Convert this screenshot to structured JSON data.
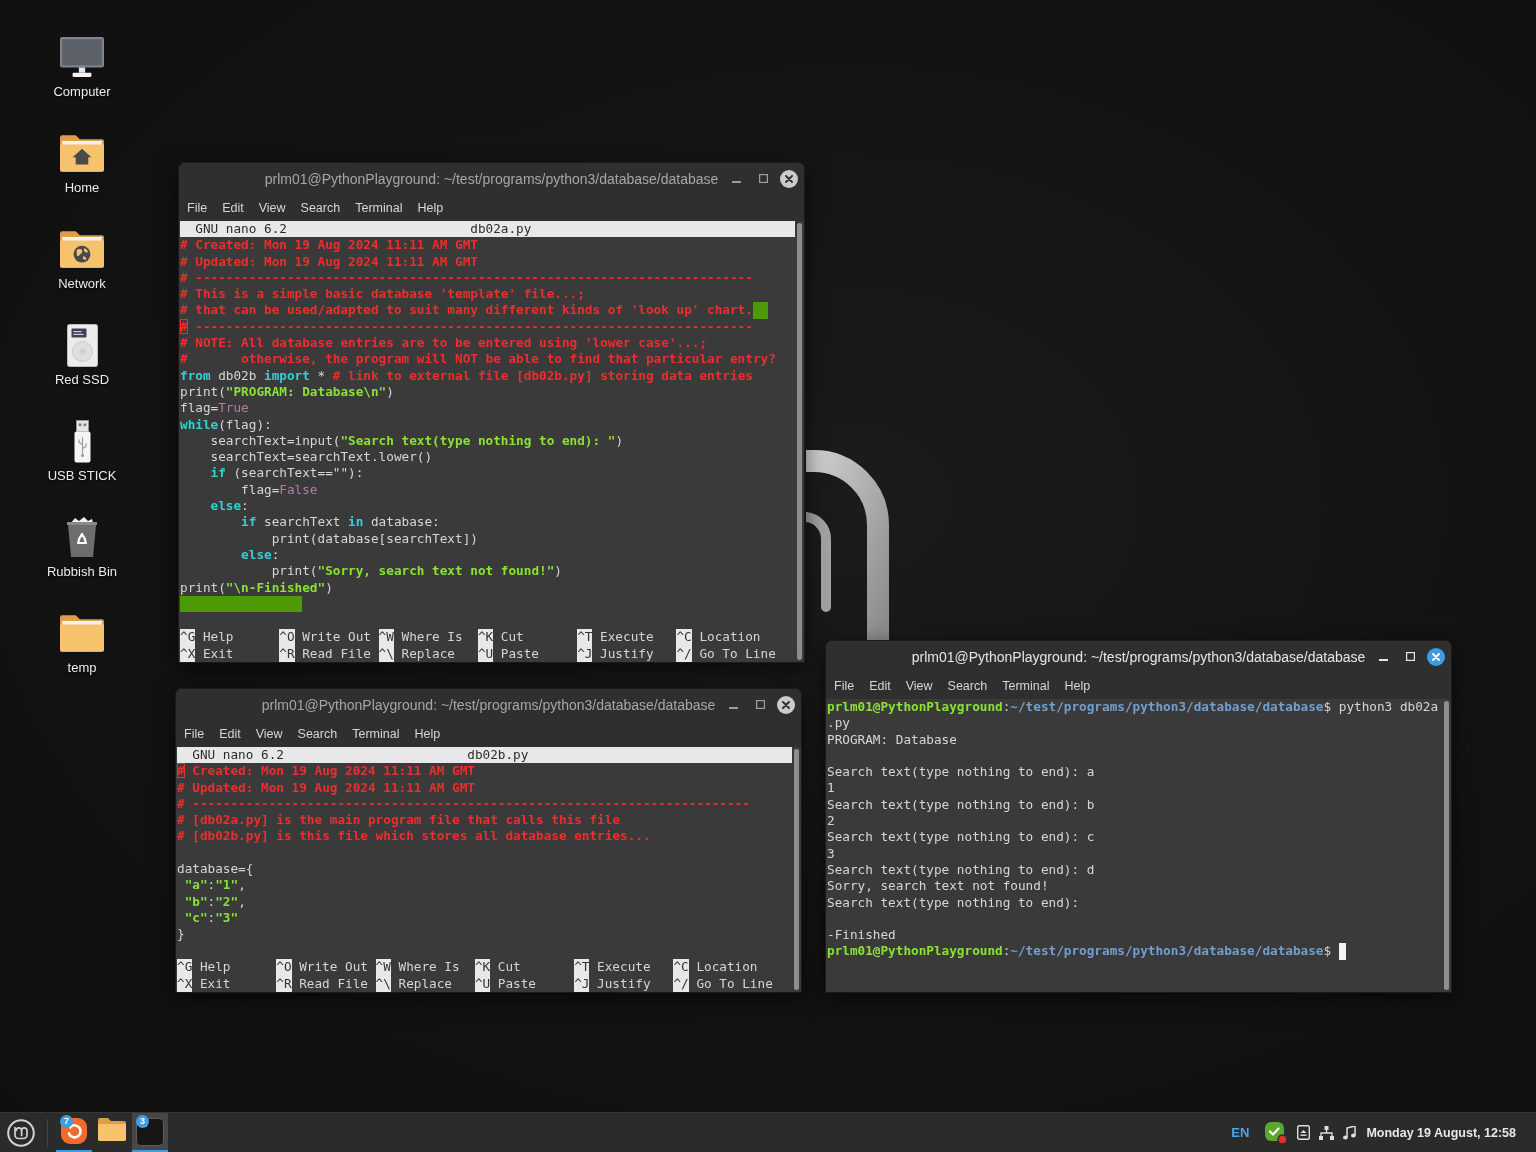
{
  "desktop_icons": [
    {
      "kind": "computer",
      "label": "Computer"
    },
    {
      "kind": "home",
      "label": "Home"
    },
    {
      "kind": "network",
      "label": "Network"
    },
    {
      "kind": "drive",
      "label": "Red SSD"
    },
    {
      "kind": "usb",
      "label": "USB STICK"
    },
    {
      "kind": "trash",
      "label": "Rubbish Bin"
    },
    {
      "kind": "folder",
      "label": "temp"
    }
  ],
  "windows": [
    {
      "kind": "nano",
      "active": false,
      "title": "prlm01@PythonPlayground: ~/test/programs/python3/database/database",
      "menu": [
        "File",
        "Edit",
        "View",
        "Search",
        "Terminal",
        "Help"
      ],
      "editor": {
        "version": "GNU nano 6.2",
        "filename": "db02a.py"
      },
      "lines": [
        {
          "kind": "code",
          "spans": [
            {
              "kind": "comment",
              "t": "# Created: Mon 19 Aug 2024 11:11 AM GMT"
            }
          ]
        },
        {
          "kind": "code",
          "spans": [
            {
              "kind": "comment",
              "t": "# Updated: Mon 19 Aug 2024 11:11 AM GMT"
            }
          ]
        },
        {
          "kind": "code",
          "spans": [
            {
              "kind": "comment",
              "t": "# -------------------------------------------------------------------------"
            }
          ]
        },
        {
          "kind": "code",
          "spans": [
            {
              "kind": "comment",
              "t": "# This is a simple basic database 'template' file...;"
            }
          ]
        },
        {
          "kind": "code",
          "spans": [
            {
              "kind": "comment",
              "t": "# that can be used/adapted to suit many different kinds of 'look up' chart."
            },
            {
              "kind": "space"
            },
            {
              "kind": "space"
            }
          ]
        },
        {
          "kind": "code",
          "spans": [
            {
              "kind": "comment",
              "t": "#",
              "cursor": true
            },
            {
              "kind": "comment",
              "t": " -------------------------------------------------------------------------"
            }
          ]
        },
        {
          "kind": "code",
          "spans": [
            {
              "kind": "comment",
              "t": "# NOTE: All database entries are to be entered using 'lower case'...;"
            }
          ]
        },
        {
          "kind": "code",
          "spans": [
            {
              "kind": "comment",
              "t": "#       otherwise, the program will NOT be able to find that particular entry?"
            }
          ]
        },
        {
          "kind": "code",
          "spans": [
            {
              "kind": "keyword",
              "t": "from"
            },
            {
              "kind": "plain",
              "t": " db02b "
            },
            {
              "kind": "keyword",
              "t": "import"
            },
            {
              "kind": "plain",
              "t": " * "
            },
            {
              "kind": "comment",
              "t": "# link to external file [db02b.py] storing data entries"
            }
          ]
        },
        {
          "kind": "code",
          "spans": [
            {
              "kind": "plain",
              "t": "print("
            },
            {
              "kind": "string",
              "t": "\"PROGRAM: Database\\n\""
            },
            {
              "kind": "plain",
              "t": ")"
            }
          ]
        },
        {
          "kind": "code",
          "spans": [
            {
              "kind": "plain",
              "t": "flag="
            },
            {
              "kind": "constant",
              "t": "True"
            }
          ]
        },
        {
          "kind": "code",
          "spans": [
            {
              "kind": "keyword",
              "t": "while"
            },
            {
              "kind": "plain",
              "t": "(flag):"
            }
          ]
        },
        {
          "kind": "code",
          "spans": [
            {
              "kind": "plain",
              "t": "    searchText=input("
            },
            {
              "kind": "string",
              "t": "\"Search text(type nothing to end): \""
            },
            {
              "kind": "plain",
              "t": ")"
            }
          ]
        },
        {
          "kind": "code",
          "spans": [
            {
              "kind": "plain",
              "t": "    searchText=searchText.lower()"
            }
          ]
        },
        {
          "kind": "code",
          "spans": [
            {
              "kind": "keyword",
              "t": "    if"
            },
            {
              "kind": "plain",
              "t": " (searchText==\"\"):"
            }
          ]
        },
        {
          "kind": "code",
          "spans": [
            {
              "kind": "plain",
              "t": "        flag="
            },
            {
              "kind": "constant",
              "t": "False"
            }
          ]
        },
        {
          "kind": "code",
          "spans": [
            {
              "kind": "keyword",
              "t": "    else"
            },
            {
              "kind": "plain",
              "t": ":"
            }
          ]
        },
        {
          "kind": "code",
          "spans": [
            {
              "kind": "keyword",
              "t": "        if"
            },
            {
              "kind": "plain",
              "t": " searchText "
            },
            {
              "kind": "keyword",
              "t": "in"
            },
            {
              "kind": "plain",
              "t": " database:"
            }
          ]
        },
        {
          "kind": "code",
          "spans": [
            {
              "kind": "plain",
              "t": "            print(database[searchText])"
            }
          ]
        },
        {
          "kind": "code",
          "spans": [
            {
              "kind": "keyword",
              "t": "        else"
            },
            {
              "kind": "plain",
              "t": ":"
            }
          ]
        },
        {
          "kind": "code",
          "spans": [
            {
              "kind": "plain",
              "t": "            print("
            },
            {
              "kind": "string",
              "t": "\"Sorry, search text not found!\""
            },
            {
              "kind": "plain",
              "t": ")"
            }
          ]
        },
        {
          "kind": "code",
          "spans": [
            {
              "kind": "plain",
              "t": "print("
            },
            {
              "kind": "string",
              "t": "\"\\n-Finished\""
            },
            {
              "kind": "plain",
              "t": ")"
            }
          ]
        },
        {
          "kind": "code",
          "spans": [
            {
              "kind": "space"
            },
            {
              "kind": "space"
            },
            {
              "kind": "space"
            },
            {
              "kind": "space"
            },
            {
              "kind": "space"
            },
            {
              "kind": "space"
            },
            {
              "kind": "space"
            },
            {
              "kind": "space"
            },
            {
              "kind": "space"
            },
            {
              "kind": "space"
            },
            {
              "kind": "space"
            },
            {
              "kind": "space"
            },
            {
              "kind": "space"
            },
            {
              "kind": "space"
            },
            {
              "kind": "space"
            },
            {
              "kind": "space"
            }
          ]
        }
      ],
      "shortcut_rows": [
        [
          {
            "key": "^G",
            "label": "Help"
          },
          {
            "key": "^O",
            "label": "Write Out"
          },
          {
            "key": "^W",
            "label": "Where Is"
          },
          {
            "key": "^K",
            "label": "Cut"
          },
          {
            "key": "^T",
            "label": "Execute"
          },
          {
            "key": "^C",
            "label": "Location"
          }
        ],
        [
          {
            "key": "^X",
            "label": "Exit"
          },
          {
            "key": "^R",
            "label": "Read File"
          },
          {
            "key": "^\\",
            "label": "Replace"
          },
          {
            "key": "^U",
            "label": "Paste"
          },
          {
            "key": "^J",
            "label": "Justify"
          },
          {
            "key": "^/",
            "label": "Go To Line"
          }
        ]
      ]
    },
    {
      "kind": "nano",
      "active": false,
      "title": "prlm01@PythonPlayground: ~/test/programs/python3/database/database",
      "menu": [
        "File",
        "Edit",
        "View",
        "Search",
        "Terminal",
        "Help"
      ],
      "editor": {
        "version": "GNU nano 6.2",
        "filename": "db02b.py"
      },
      "lines": [
        {
          "kind": "code",
          "spans": [
            {
              "kind": "comment",
              "t": "#",
              "cursor": true
            },
            {
              "kind": "comment",
              "t": " Created: Mon 19 Aug 2024 11:11 AM GMT"
            }
          ]
        },
        {
          "kind": "code",
          "spans": [
            {
              "kind": "comment",
              "t": "# Updated: Mon 19 Aug 2024 11:11 AM GMT"
            }
          ]
        },
        {
          "kind": "code",
          "spans": [
            {
              "kind": "comment",
              "t": "# -------------------------------------------------------------------------"
            }
          ]
        },
        {
          "kind": "code",
          "spans": [
            {
              "kind": "comment",
              "t": "# [db02a.py] is the main program file that calls this file"
            }
          ]
        },
        {
          "kind": "code",
          "spans": [
            {
              "kind": "comment",
              "t": "# [db02b.py] is this file which stores all database entries..."
            }
          ]
        },
        {
          "kind": "blank"
        },
        {
          "kind": "code",
          "spans": [
            {
              "kind": "plain",
              "t": "database={"
            }
          ]
        },
        {
          "kind": "code",
          "spans": [
            {
              "kind": "string",
              "t": " \"a\""
            },
            {
              "kind": "plain",
              "t": ":"
            },
            {
              "kind": "string",
              "t": "\"1\""
            },
            {
              "kind": "plain",
              "t": ","
            }
          ]
        },
        {
          "kind": "code",
          "spans": [
            {
              "kind": "string",
              "t": " \"b\""
            },
            {
              "kind": "plain",
              "t": ":"
            },
            {
              "kind": "string",
              "t": "\"2\""
            },
            {
              "kind": "plain",
              "t": ","
            }
          ]
        },
        {
          "kind": "code",
          "spans": [
            {
              "kind": "string",
              "t": " \"c\""
            },
            {
              "kind": "plain",
              "t": ":"
            },
            {
              "kind": "string",
              "t": "\"3\""
            }
          ]
        },
        {
          "kind": "code",
          "spans": [
            {
              "kind": "plain",
              "t": "}"
            }
          ]
        }
      ],
      "shortcut_rows": [
        [
          {
            "key": "^G",
            "label": "Help"
          },
          {
            "key": "^O",
            "label": "Write Out"
          },
          {
            "key": "^W",
            "label": "Where Is"
          },
          {
            "key": "^K",
            "label": "Cut"
          },
          {
            "key": "^T",
            "label": "Execute"
          },
          {
            "key": "^C",
            "label": "Location"
          }
        ],
        [
          {
            "key": "^X",
            "label": "Exit"
          },
          {
            "key": "^R",
            "label": "Read File"
          },
          {
            "key": "^\\",
            "label": "Replace"
          },
          {
            "key": "^U",
            "label": "Paste"
          },
          {
            "key": "^J",
            "label": "Justify"
          },
          {
            "key": "^/",
            "label": "Go To Line"
          }
        ]
      ]
    },
    {
      "kind": "terminal",
      "active": true,
      "title": "prlm01@PythonPlayground: ~/test/programs/python3/database/database",
      "menu": [
        "File",
        "Edit",
        "View",
        "Search",
        "Terminal",
        "Help"
      ],
      "cursor": true,
      "lines": [
        {
          "kind": "code",
          "spans": [
            {
              "kind": "user",
              "t": "prlm01@PythonPlayground"
            },
            {
              "kind": "plain",
              "t": ":"
            },
            {
              "kind": "path",
              "t": "~/test/programs/python3/database/database"
            },
            {
              "kind": "plain",
              "t": "$ python3 db02a"
            }
          ]
        },
        {
          "kind": "code",
          "spans": [
            {
              "kind": "plain",
              "t": ".py"
            }
          ]
        },
        {
          "kind": "code",
          "spans": [
            {
              "kind": "plain",
              "t": "PROGRAM: Database"
            }
          ]
        },
        {
          "kind": "blank"
        },
        {
          "kind": "code",
          "spans": [
            {
              "kind": "plain",
              "t": "Search text(type nothing to end): a"
            }
          ]
        },
        {
          "kind": "code",
          "spans": [
            {
              "kind": "plain",
              "t": "1"
            }
          ]
        },
        {
          "kind": "code",
          "spans": [
            {
              "kind": "plain",
              "t": "Search text(type nothing to end): b"
            }
          ]
        },
        {
          "kind": "code",
          "spans": [
            {
              "kind": "plain",
              "t": "2"
            }
          ]
        },
        {
          "kind": "code",
          "spans": [
            {
              "kind": "plain",
              "t": "Search text(type nothing to end): c"
            }
          ]
        },
        {
          "kind": "code",
          "spans": [
            {
              "kind": "plain",
              "t": "3"
            }
          ]
        },
        {
          "kind": "code",
          "spans": [
            {
              "kind": "plain",
              "t": "Search text(type nothing to end): d"
            }
          ]
        },
        {
          "kind": "code",
          "spans": [
            {
              "kind": "plain",
              "t": "Sorry, search text not found!"
            }
          ]
        },
        {
          "kind": "code",
          "spans": [
            {
              "kind": "plain",
              "t": "Search text(type nothing to end):"
            }
          ]
        },
        {
          "kind": "blank"
        },
        {
          "kind": "code",
          "spans": [
            {
              "kind": "plain",
              "t": "-Finished"
            }
          ]
        },
        {
          "kind": "code",
          "spans": [
            {
              "kind": "user",
              "t": "prlm01@PythonPlayground"
            },
            {
              "kind": "plain",
              "t": ":"
            },
            {
              "kind": "path",
              "t": "~/test/programs/python3/database/database"
            },
            {
              "kind": "plain",
              "t": "$ "
            }
          ]
        }
      ]
    }
  ],
  "taskbar": {
    "apps": [
      {
        "kind": "browser",
        "badge": "7",
        "running": true,
        "active": false
      },
      {
        "kind": "files",
        "running": false,
        "active": false
      },
      {
        "kind": "terminal",
        "badge": "3",
        "running": true,
        "active": true
      }
    ],
    "keyboard_layout": "EN",
    "clock": "Monday 19 August, 12:58"
  }
}
